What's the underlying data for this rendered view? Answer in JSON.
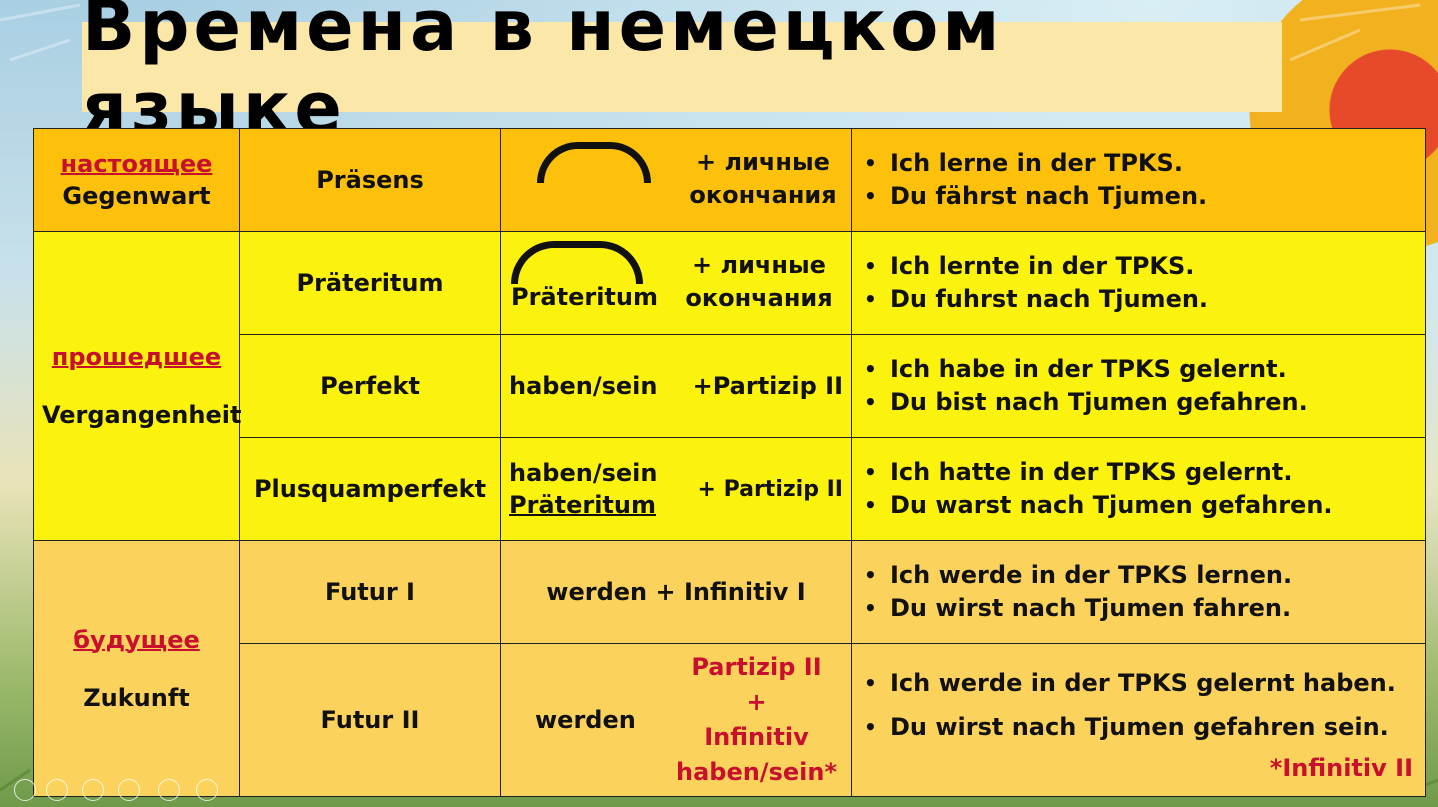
{
  "title": "Времена в немецком языке",
  "present": {
    "label_ru": "настоящее",
    "label_de": "Gegenwart",
    "tense": "Präsens",
    "ending": [
      "+ личные",
      "окончания"
    ],
    "examples": [
      "Ich lerne in der TPKS.",
      "Du fährst nach Tjumen."
    ]
  },
  "past": {
    "label_ru": "прошедшее",
    "label_de": "Vergangenheit",
    "rows": [
      {
        "tense": "Präteritum",
        "form_word": "Präteritum",
        "ending": [
          "+ личные",
          "окончания"
        ],
        "examples": [
          "Ich lernte in der TPKS.",
          "Du fuhrst nach Tjumen."
        ]
      },
      {
        "tense": "Perfekt",
        "aux": "haben/sein",
        "suffix": "+Partizip II",
        "examples": [
          "Ich habe in der TPKS gelernt.",
          "Du bist nach Tjumen gefahren."
        ]
      },
      {
        "tense": "Plusquamperfekt",
        "aux1": "haben/sein",
        "aux2": "Präteritum",
        "suffix": "+ Partizip II",
        "examples": [
          "Ich hatte in der TPKS gelernt.",
          "Du warst nach Tjumen gefahren."
        ]
      }
    ]
  },
  "future": {
    "label_ru": "будущее",
    "label_de": "Zukunft",
    "rows": [
      {
        "tense": "Futur I",
        "formula": "werden + Infinitiv I",
        "examples": [
          "Ich werde in der TPKS lernen.",
          "Du wirst nach Tjumen fahren."
        ]
      },
      {
        "tense": "Futur II",
        "aux": "werden",
        "parts": [
          "Partizip II",
          "+",
          "Infinitiv",
          "haben/sein*"
        ],
        "examples": [
          "Ich werde in der TPKS gelernt haben.",
          "Du wirst nach Tjumen gefahren sein."
        ],
        "note": "*Infinitiv II"
      }
    ]
  },
  "colors": {
    "present_bg": "#fdc10c",
    "past_bg": "#fbf20e",
    "future_bg": "#fbd25c",
    "accent_red": "#c8102e"
  }
}
